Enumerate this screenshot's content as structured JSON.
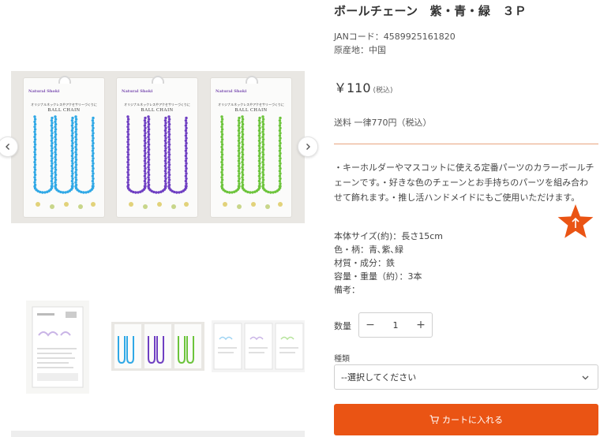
{
  "product": {
    "title": "ボールチェーン　紫・青・緑　３Ｐ",
    "jan": "JANコード：4589925161820",
    "origin": "原産地：中国",
    "price": "￥110",
    "tax_note": "(税込)",
    "shipping": "送料 一律770円（税込）"
  },
  "description": "・キーホルダーやマスコットに使える定番パーツのカラーボールチェーンです。・好きな色のチェーンとお手持ちのパーツを組み合わせて飾れます。・推し活ハンドメイドにもご使用いただけます。",
  "specs": {
    "size": "本体サイズ(約)：長さ15cm",
    "pattern": "色・柄：青､紫､緑",
    "material": "材質・成分：鉄",
    "capacity": "容量・重量（約）：3本",
    "notes": "備考："
  },
  "package": {
    "brand": "Natural Shoki",
    "label": "BALL CHAIN",
    "subtitle": "オリジナルネックレスやアクセサリーづくりに"
  },
  "cards": [
    {
      "color": "#2fa8e6"
    },
    {
      "color": "#6f3fc2"
    },
    {
      "color": "#6cc43b"
    }
  ],
  "quantity": {
    "label": "数量",
    "value": "1",
    "minus": "−",
    "plus": "+"
  },
  "variant": {
    "label": "種類",
    "placeholder": "--選択してください"
  },
  "cart": {
    "label": "カートに入れる"
  },
  "colors": {
    "accent": "#ea5414",
    "divider": "#e8a57f"
  }
}
